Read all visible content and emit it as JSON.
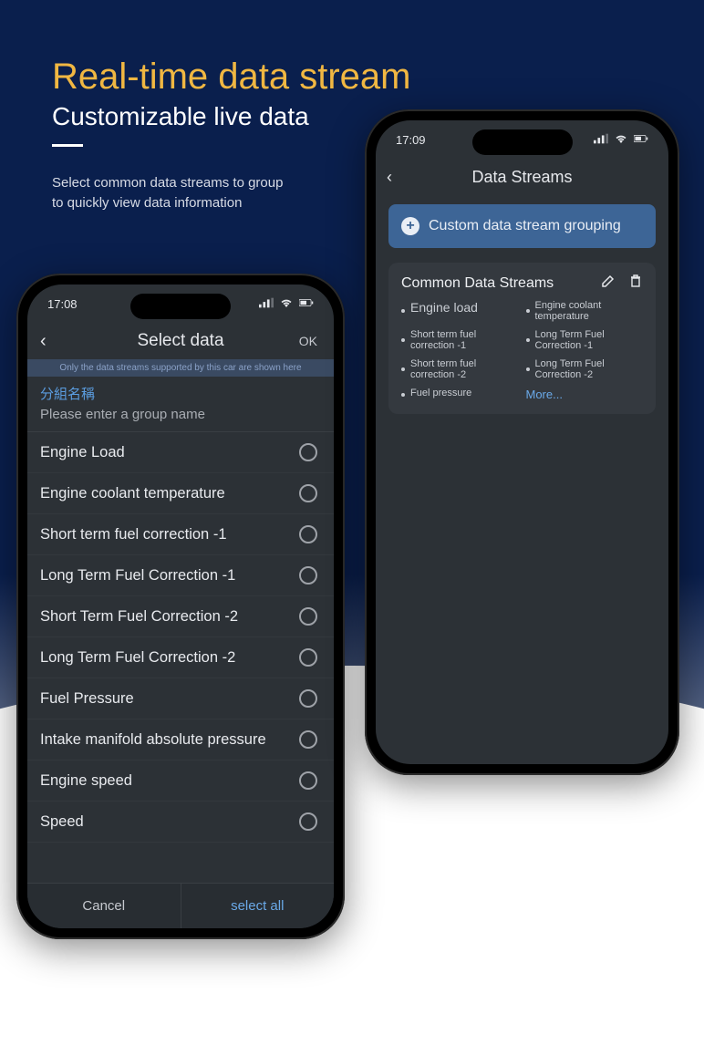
{
  "hero": {
    "title": "Real-time data stream",
    "subtitle": "Customizable live data",
    "blurb": "Select common data streams to group to quickly view data information"
  },
  "left": {
    "status_time": "17:08",
    "nav_title": "Select data",
    "nav_ok": "OK",
    "hint": "Only the data streams supported by this car are shown here",
    "group_label": "分組名稱",
    "group_placeholder": "Please enter a group name",
    "items": [
      "Engine Load",
      "Engine coolant temperature",
      "Short term fuel correction -1",
      "Long Term Fuel Correction -1",
      "Short Term Fuel Correction -2",
      "Long Term Fuel Correction -2",
      "Fuel Pressure",
      "Intake manifold absolute pressure",
      "Engine speed",
      "Speed"
    ],
    "cancel": "Cancel",
    "select_all": "select all"
  },
  "right": {
    "status_time": "17:09",
    "nav_title": "Data Streams",
    "custom_btn": "Custom data stream grouping",
    "common_title": "Common Data Streams",
    "streams_left": [
      "Engine load",
      "Short term fuel correction -1",
      "Short term fuel correction -2",
      "Fuel pressure"
    ],
    "streams_right": [
      "Engine coolant temperature",
      "Long Term Fuel Correction -1",
      "Long Term Fuel Correction -2"
    ],
    "more": "More..."
  }
}
